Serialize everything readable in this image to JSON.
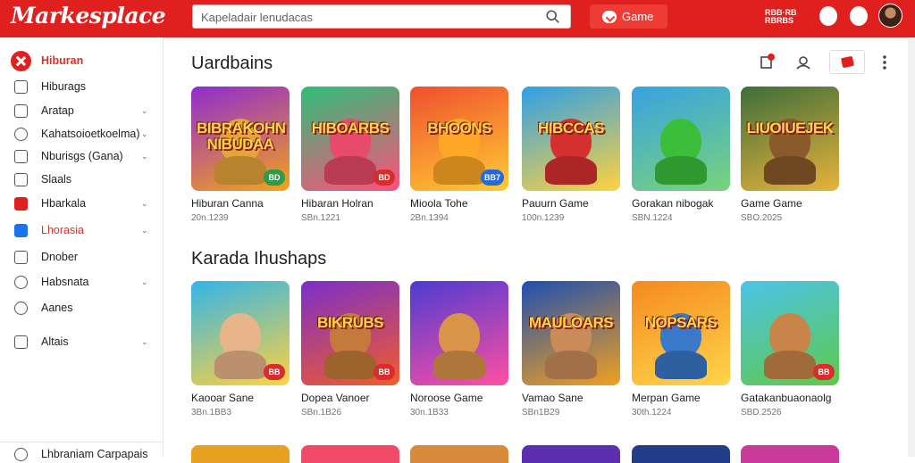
{
  "app": {
    "logo": "Markesplace"
  },
  "search": {
    "placeholder": "Kapeladair lenudacas"
  },
  "topbar": {
    "game_button": "Game",
    "mini_text": "RBB·RB RBRBS"
  },
  "sidebar": {
    "items": [
      {
        "label": "Hiburan",
        "icon": "close-icon",
        "active": true
      },
      {
        "label": "Hiburags",
        "icon": "grid-icon"
      },
      {
        "label": "Aratap",
        "icon": "briefcase-icon",
        "chevron": "⌄"
      },
      {
        "label": "Kahatsoioetkoelma)",
        "icon": "clock-icon",
        "chevron": "⌄"
      },
      {
        "label": "Nburisgs (Gana)",
        "icon": "tag-icon",
        "chevron": "⌄"
      },
      {
        "label": "Slaals",
        "icon": "grid-icon"
      },
      {
        "label": "Hbarkala",
        "icon": "media-icon",
        "chevron": "⌄"
      },
      {
        "label": "Lhorasia",
        "icon": "app-icon",
        "chevron": "⌄"
      },
      {
        "label": "Dnober",
        "icon": "window-icon"
      },
      {
        "label": "Habsnata",
        "icon": "help-icon",
        "chevron": "⌄"
      },
      {
        "label": "Aanes",
        "icon": "info-icon"
      },
      {
        "label": "Altais",
        "icon": "settings-icon",
        "chevron": "⌄"
      }
    ],
    "footer": "Lhbraniam Carpapais"
  },
  "sections": [
    {
      "title": "Uardbains",
      "cards": [
        {
          "thumb_text": "BIBRAKOHN NIBUDAA",
          "title": "Hiburan Canna",
          "sub": "20n.1239",
          "badge": "BD",
          "badge_color": "#2e9b4a",
          "bg": [
            "#8f2bd1",
            "#f6a21a"
          ],
          "char": "#e5a43a"
        },
        {
          "thumb_text": "HIBOARBS",
          "title": "Hibaran Holran",
          "sub": "SBn.1221",
          "badge": "BD",
          "badge_color": "#d92c2c",
          "bg": [
            "#2dbf77",
            "#ff4f7c"
          ],
          "char": "#e84a6c"
        },
        {
          "thumb_text": "BHOONS",
          "title": "Mioola Tohe",
          "sub": "2Bn.1394",
          "badge": "BB7",
          "badge_color": "#2769d8",
          "bg": [
            "#f04e2e",
            "#ffcc33"
          ],
          "char": "#ffa726"
        },
        {
          "thumb_text": "HIBCCAS",
          "title": "Pauurn Game",
          "sub": "100n.1239",
          "badge": "",
          "badge_color": "#ffffff",
          "bg": [
            "#2e9fe8",
            "#ffd23f"
          ],
          "char": "#d62f2f"
        },
        {
          "thumb_text": "",
          "title": "Gorakan nibogak",
          "sub": "SBN.1224",
          "badge": "",
          "badge_color": "#ffffff",
          "bg": [
            "#37a2e3",
            "#7ad37a"
          ],
          "char": "#3bbf3b"
        },
        {
          "thumb_text": "LIUOIUEJEK",
          "title": "Game Game",
          "sub": "SBO.2025",
          "badge": "",
          "badge_color": "#ffffff",
          "bg": [
            "#3d6e3a",
            "#e8b33b"
          ],
          "char": "#8b5a2b"
        }
      ]
    },
    {
      "title": "Karada Ihushaps",
      "cards": [
        {
          "thumb_text": "",
          "title": "Kaooar Sane",
          "sub": "3Bn.1BB3",
          "badge": "BB",
          "badge_color": "#d92c2c",
          "bg": [
            "#32b5e8",
            "#ffd23f"
          ],
          "char": "#e8b48a"
        },
        {
          "thumb_text": "BIKRUBS",
          "title": "Dopea Vanoer",
          "sub": "SBn.1B26",
          "badge": "BB",
          "badge_color": "#d92c2c",
          "bg": [
            "#7b2fc9",
            "#f25c2b"
          ],
          "char": "#c47a3a"
        },
        {
          "thumb_text": "",
          "title": "Noroose Game",
          "sub": "30n.1B33",
          "badge": "",
          "badge_color": "#ffffff",
          "bg": [
            "#4d3bd1",
            "#ff4fa3"
          ],
          "char": "#d9944a"
        },
        {
          "thumb_text": "MAULOARS",
          "title": "Vamao Sane",
          "sub": "SBn1B29",
          "badge": "",
          "badge_color": "#ffffff",
          "bg": [
            "#1e4fb0",
            "#f0a020"
          ],
          "char": "#c98b5a"
        },
        {
          "thumb_text": "NOPSARS",
          "title": "Merpan Game",
          "sub": "30th.1224",
          "badge": "",
          "badge_color": "#ffffff",
          "bg": [
            "#f58a1f",
            "#ffd54a"
          ],
          "char": "#3a78c9"
        },
        {
          "thumb_text": "",
          "title": "Gatakanbuaonaolg",
          "sub": "SBD.2526",
          "badge": "BB",
          "badge_color": "#d92c2c",
          "bg": [
            "#4cc3e8",
            "#5fc94a"
          ],
          "char": "#c9844a"
        }
      ]
    }
  ],
  "bottom_row_colors": [
    "#e8a020",
    "#f24b6a",
    "#d98a3a",
    "#5b2fb0",
    "#233d8a",
    "#c93a9a"
  ]
}
